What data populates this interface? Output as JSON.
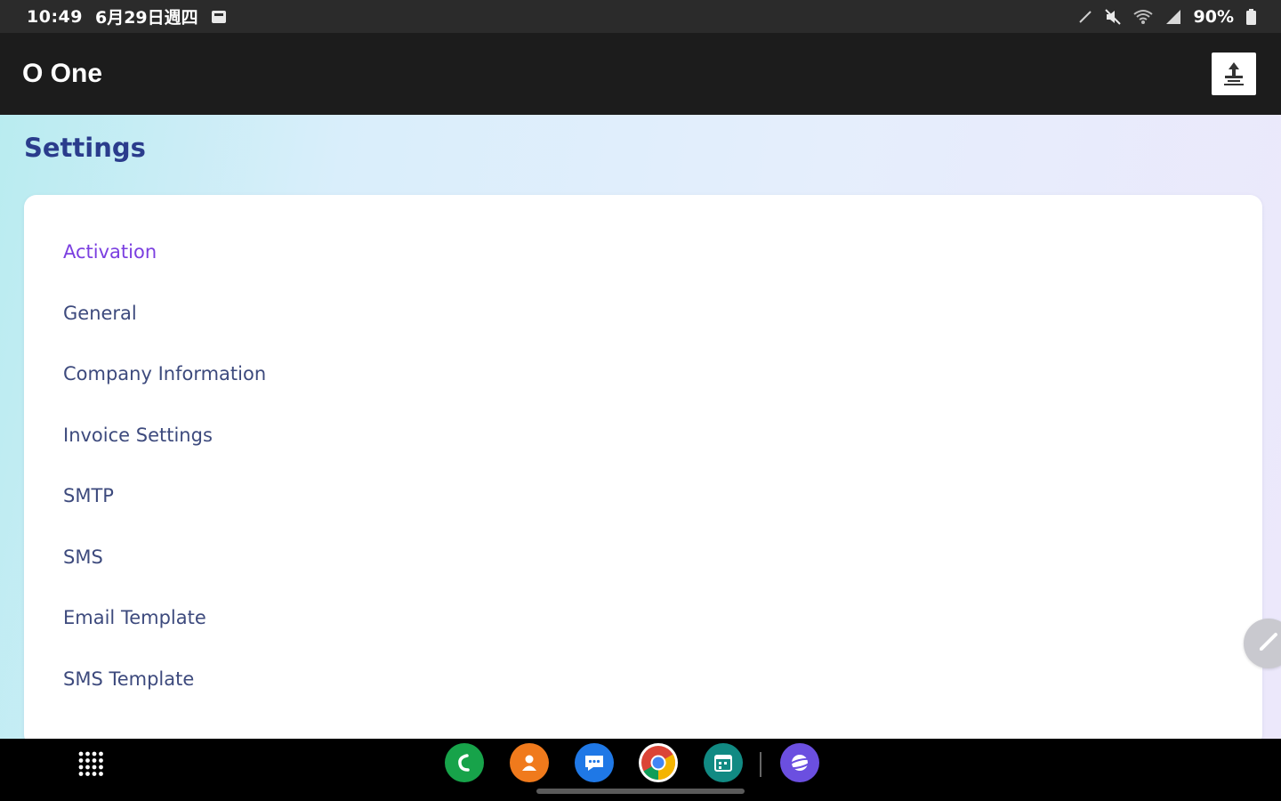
{
  "status_bar": {
    "time": "10:49",
    "date": "6月29日週四",
    "battery": "90%",
    "icons": [
      "notification-card-icon",
      "pen-icon",
      "mute-icon",
      "wifi-icon",
      "signal-icon",
      "battery-icon"
    ]
  },
  "app_bar": {
    "title": "O One",
    "logo_icon": "company-logo-icon"
  },
  "page": {
    "title": "Settings"
  },
  "settings": {
    "items": [
      {
        "label": "Activation",
        "active": true
      },
      {
        "label": "General",
        "active": false
      },
      {
        "label": "Company Information",
        "active": false
      },
      {
        "label": "Invoice Settings",
        "active": false
      },
      {
        "label": "SMTP",
        "active": false
      },
      {
        "label": "SMS",
        "active": false
      },
      {
        "label": "Email Template",
        "active": false
      },
      {
        "label": "SMS Template",
        "active": false
      }
    ]
  },
  "floating_button": {
    "icon": "pencil-icon"
  },
  "taskbar": {
    "apps": [
      {
        "name": "phone",
        "color": "#17a34a"
      },
      {
        "name": "contacts",
        "color": "#f07a1c"
      },
      {
        "name": "messages",
        "color": "#1f78e6"
      },
      {
        "name": "chrome",
        "color": "#ffffff"
      },
      {
        "name": "calendar",
        "color": "#118a83"
      },
      {
        "name": "internet",
        "color": "#6b4fe0"
      }
    ]
  },
  "colors": {
    "accent_active": "#7b3fe0",
    "list_text": "#3d4a7d",
    "title_text": "#2a3c8c",
    "app_bar_bg": "#1c1c1c"
  }
}
